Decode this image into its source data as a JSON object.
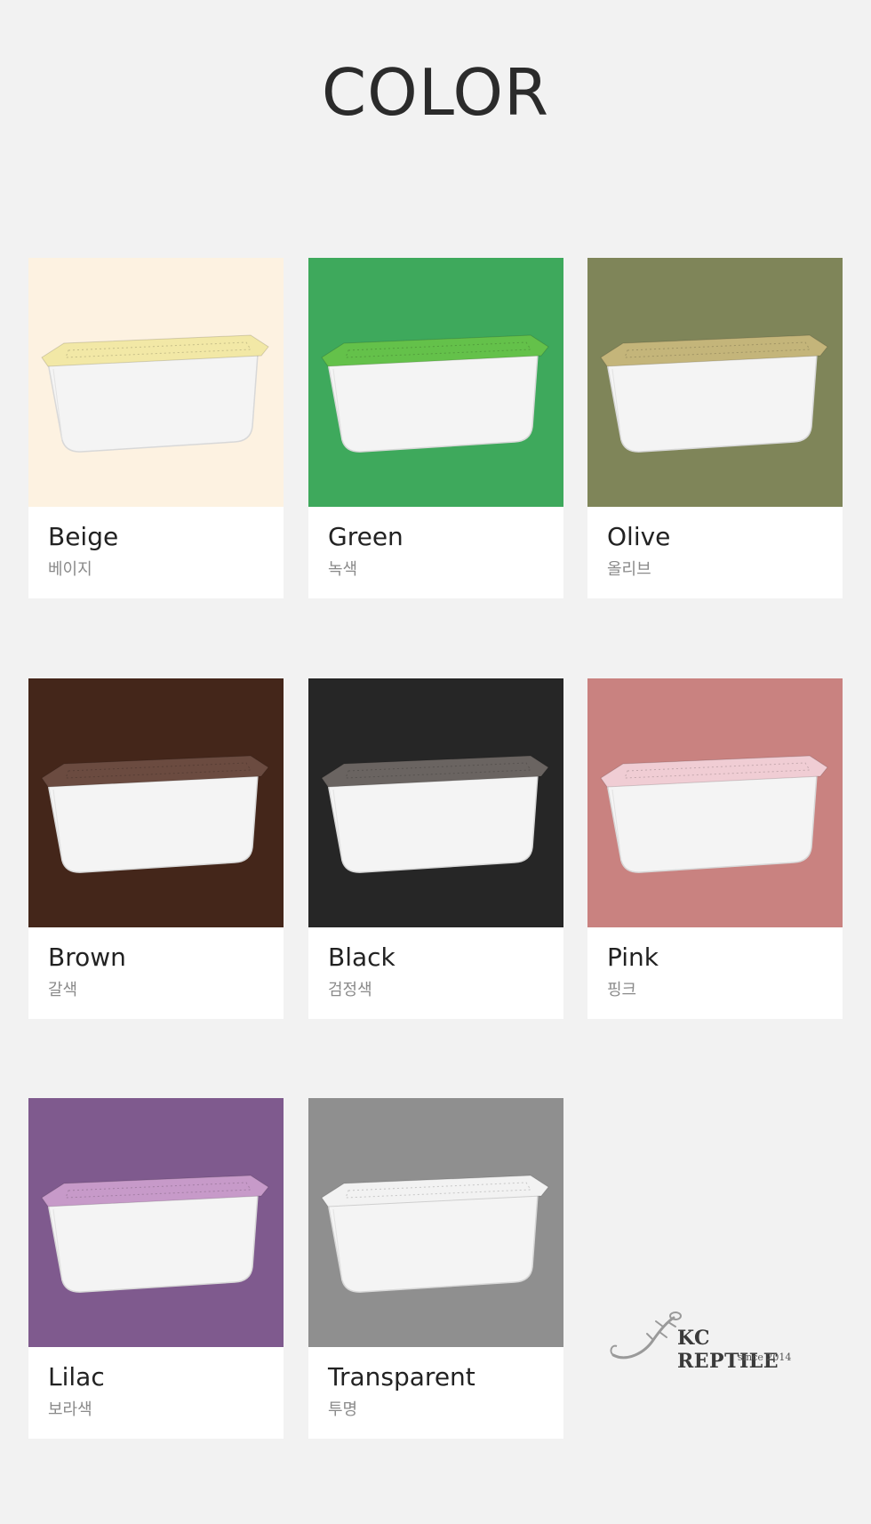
{
  "title": "COLOR",
  "colors": [
    {
      "name": "Beige",
      "sub": "베이지",
      "bg": "#fdf2e1",
      "lid": "#f2e8a6"
    },
    {
      "name": "Green",
      "sub": "녹색",
      "bg": "#3ea95c",
      "lid": "#64c14a"
    },
    {
      "name": "Olive",
      "sub": "올리브",
      "bg": "#7f8559",
      "lid": "#c4b57a"
    },
    {
      "name": "Brown",
      "sub": "갈색",
      "bg": "#44261a",
      "lid": "#6b4b40"
    },
    {
      "name": "Black",
      "sub": "검정색",
      "bg": "#262626",
      "lid": "#6a6461"
    },
    {
      "name": "Pink",
      "sub": "핑크",
      "bg": "#c98280",
      "lid": "#f0cdd4"
    },
    {
      "name": "Lilac",
      "sub": "보라색",
      "bg": "#7f5a8e",
      "lid": "#c79ac9"
    },
    {
      "name": "Transparent",
      "sub": "투명",
      "bg": "#8f8f8f",
      "lid": "#f2f2f2"
    }
  ],
  "logo": {
    "text": "KC REPTILE",
    "sub": "since 2014",
    "icon": "gecko-icon"
  }
}
